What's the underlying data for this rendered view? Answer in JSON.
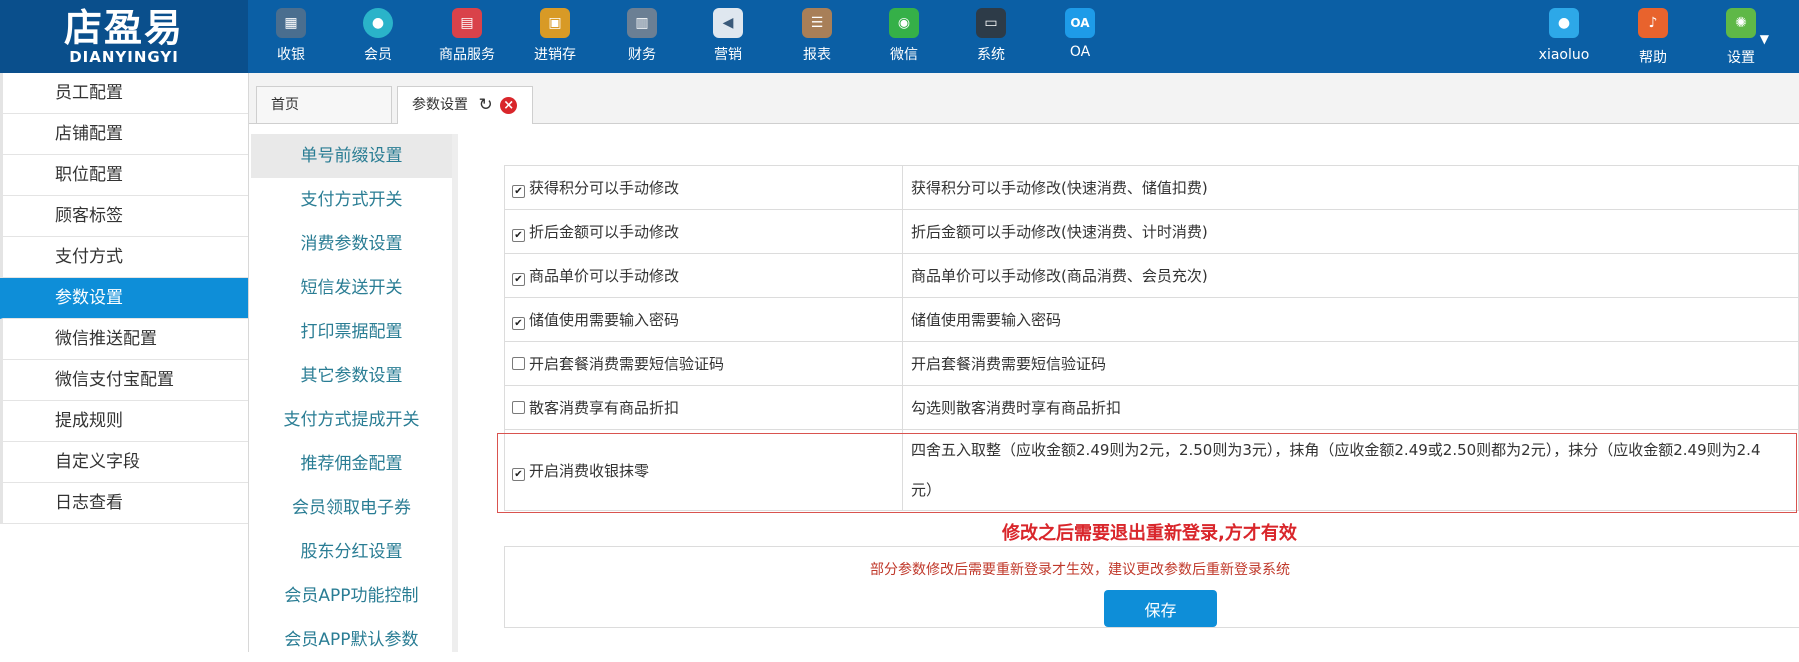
{
  "logo": {
    "cn": "店盈易",
    "en": "DIANYINGYI"
  },
  "nav": [
    {
      "label": "收银",
      "icon": "cash-register-icon",
      "color": "#4a6e8f"
    },
    {
      "label": "会员",
      "icon": "member-icon",
      "color": "#2ab3c9"
    },
    {
      "label": "商品服务",
      "icon": "product-icon",
      "color": "#d9424a"
    },
    {
      "label": "进销存",
      "icon": "inventory-icon",
      "color": "#d89a26"
    },
    {
      "label": "财务",
      "icon": "finance-icon",
      "color": "#6b7f94"
    },
    {
      "label": "营销",
      "icon": "megaphone-icon",
      "color": "#dfe7ef"
    },
    {
      "label": "报表",
      "icon": "report-icon",
      "color": "#a87f58"
    },
    {
      "label": "微信",
      "icon": "wechat-icon",
      "color": "#35b048"
    },
    {
      "label": "系统",
      "icon": "monitor-icon",
      "color": "#2d3b48"
    },
    {
      "label": "OA",
      "icon": "oa-icon",
      "color": "#1e9be8",
      "glyph": "OA"
    }
  ],
  "user_nav": [
    {
      "label": "xiaoluo",
      "icon": "user-icon",
      "color": "#2da8e8"
    },
    {
      "label": "帮助",
      "icon": "bell-icon",
      "color": "#e8632d"
    },
    {
      "label": "设置",
      "icon": "gear-icon",
      "color": "#5fb847"
    }
  ],
  "left_menu": [
    {
      "label": "员工配置",
      "active": false
    },
    {
      "label": "店铺配置",
      "active": false
    },
    {
      "label": "职位配置",
      "active": false
    },
    {
      "label": "顾客标签",
      "active": false
    },
    {
      "label": "支付方式",
      "active": false
    },
    {
      "label": "参数设置",
      "active": true
    },
    {
      "label": "微信推送配置",
      "active": false
    },
    {
      "label": "微信支付宝配置",
      "active": false
    },
    {
      "label": "提成规则",
      "active": false
    },
    {
      "label": "自定义字段",
      "active": false
    },
    {
      "label": "日志查看",
      "active": false
    }
  ],
  "tabs": [
    {
      "label": "首页",
      "active": false
    },
    {
      "label": "参数设置",
      "active": true
    }
  ],
  "sub_menu": [
    {
      "label": "单号前缀设置",
      "active": true
    },
    {
      "label": "支付方式开关",
      "active": false
    },
    {
      "label": "消费参数设置",
      "active": false
    },
    {
      "label": "短信发送开关",
      "active": false
    },
    {
      "label": "打印票据配置",
      "active": false
    },
    {
      "label": "其它参数设置",
      "active": false
    },
    {
      "label": "支付方式提成开关",
      "active": false
    },
    {
      "label": "推荐佣金配置",
      "active": false
    },
    {
      "label": "会员领取电子券",
      "active": false
    },
    {
      "label": "股东分红设置",
      "active": false
    },
    {
      "label": "会员APP功能控制",
      "active": false
    },
    {
      "label": "会员APP默认参数",
      "active": false
    }
  ],
  "settings": [
    {
      "label": "获得积分可以手动修改",
      "checked": true,
      "desc": "获得积分可以手动修改(快速消费、储值扣费)"
    },
    {
      "label": "折后金额可以手动修改",
      "checked": true,
      "desc": "折后金额可以手动修改(快速消费、计时消费)"
    },
    {
      "label": "商品单价可以手动修改",
      "checked": true,
      "desc": "商品单价可以手动修改(商品消费、会员充次)"
    },
    {
      "label": "储值使用需要输入密码",
      "checked": true,
      "desc": "储值使用需要输入密码"
    },
    {
      "label": "开启套餐消费需要短信验证码",
      "checked": false,
      "desc": "开启套餐消费需要短信验证码"
    },
    {
      "label": "散客消费享有商品折扣",
      "checked": false,
      "desc": "勾选则散客消费时享有商品折扣"
    },
    {
      "label": "开启消费收银抹零",
      "checked": true,
      "desc": "四舍五入取整（应收金额2.49则为2元，2.50则为3元），抹角（应收金额2.49或2.50则都为2元），抹分（应收金额2.49则为2.4",
      "desc_cont": "元）"
    }
  ],
  "warning": "修改之后需要退出重新登录,方才有效",
  "save": {
    "note": "部分参数修改后需要重新登录才生效，建议更改参数后重新登录系统",
    "button": "保存"
  }
}
